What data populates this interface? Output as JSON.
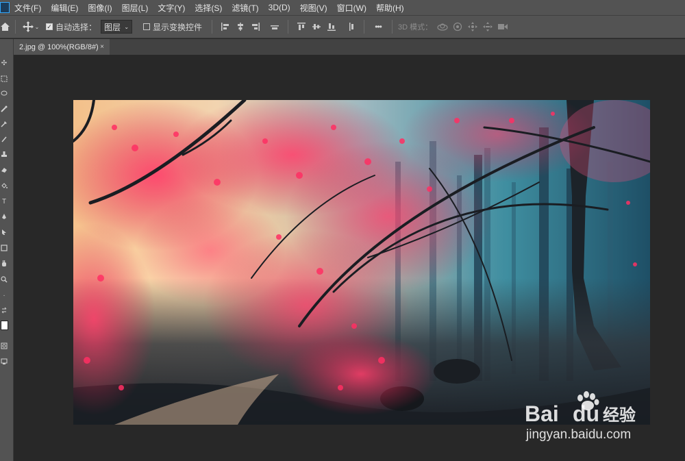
{
  "menubar": {
    "items": [
      "文件(F)",
      "编辑(E)",
      "图像(I)",
      "图层(L)",
      "文字(Y)",
      "选择(S)",
      "滤镜(T)",
      "3D(D)",
      "视图(V)",
      "窗口(W)",
      "帮助(H)"
    ]
  },
  "options": {
    "auto_select_label": "自动选择：",
    "auto_select_target": "图层",
    "show_transform_label": "显示变换控件",
    "more_label": "•••",
    "mode_3d_label": "3D 模式："
  },
  "document": {
    "tab_title": "2.jpg @ 100%(RGB/8#)",
    "close_glyph": "×"
  },
  "watermark": {
    "brand": "Bai du 经验",
    "url": "jingyan.baidu.com"
  },
  "colors": {
    "menubar_bg": "#535353",
    "canvas_bg": "#282828",
    "accent": "#31a8ff"
  }
}
